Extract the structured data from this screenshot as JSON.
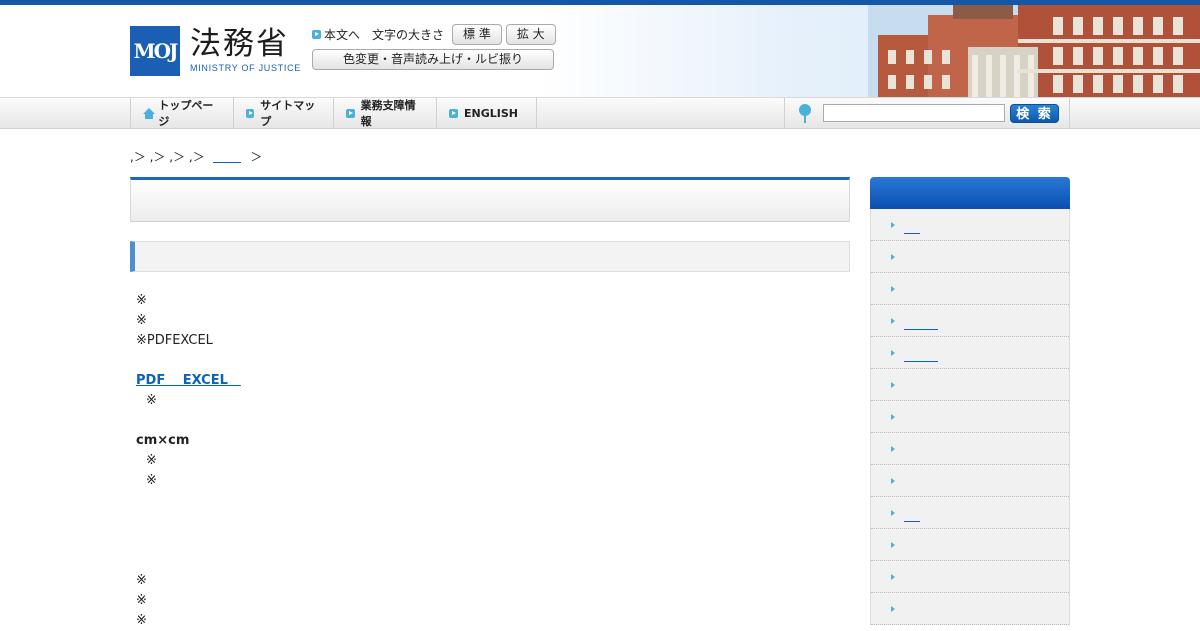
{
  "header": {
    "logo_mark": "MOJ",
    "logo_jp": "法務省",
    "logo_en": "MINISTRY OF JUSTICE",
    "skip_link": "本文へ",
    "font_size_label": "文字の大きさ",
    "font_standard": "標 準",
    "font_large": "拡 大",
    "accessibility": "色変更・音声読み上げ・ルビ振り"
  },
  "gnav": {
    "home": "トップページ",
    "sitemap": "サイトマップ",
    "support": "業務支障情報",
    "english": "ENGLISH"
  },
  "search": {
    "value": "",
    "button": "検 索"
  },
  "breadcrumb": {
    "text": ",＞ ,＞ ,＞ ,＞",
    "end": "＞"
  },
  "content": {
    "lines": [
      "※",
      "※",
      "※PDFEXCEL"
    ],
    "pdf_link": "PDF　 EXCEL　",
    "note1": "※",
    "size_label": "cm×cm",
    "notes2": [
      "※",
      "※"
    ],
    "notes3": [
      "※",
      "※",
      "※"
    ]
  },
  "colors": {
    "brand": "#1a5fb4",
    "accent": "#4bb1d9",
    "link": "#0a63b8"
  }
}
